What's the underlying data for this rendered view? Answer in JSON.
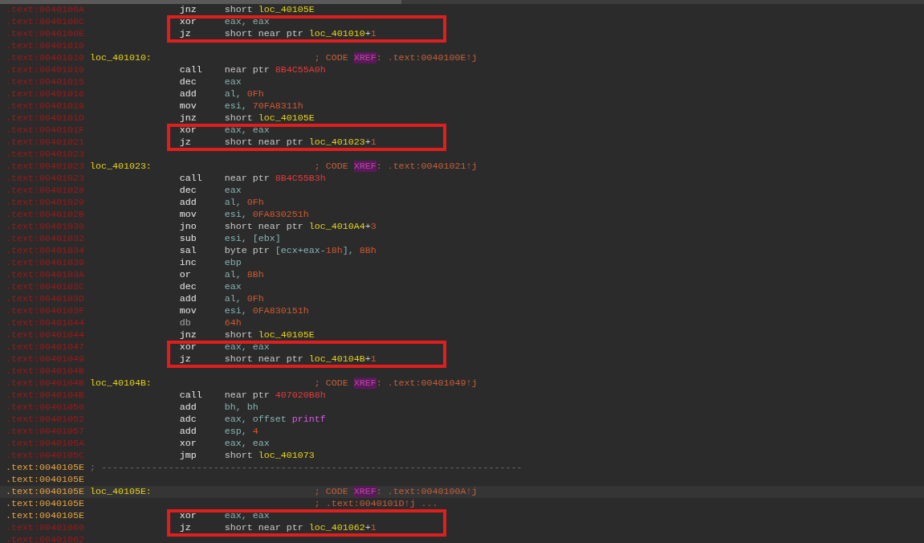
{
  "listing": [
    {
      "addr": ".text:0040100A",
      "flagged": true,
      "mnemonic": "jnz",
      "operands": [
        {
          "text": "short ",
          "kind": "kw"
        },
        {
          "text": "loc_40105E",
          "kind": "loc"
        }
      ]
    },
    {
      "addr": ".text:0040100C",
      "flagged": true,
      "boxed": true,
      "mnemonic": "xor",
      "operands": [
        {
          "text": "eax, eax",
          "kind": "reg"
        }
      ]
    },
    {
      "addr": ".text:0040100E",
      "flagged": true,
      "boxed": true,
      "mnemonic": "jz",
      "operands": [
        {
          "text": "short near ptr ",
          "kind": "kw"
        },
        {
          "text": "loc_401010",
          "kind": "loc"
        },
        {
          "text": "+",
          "kind": "kw"
        },
        {
          "text": "1",
          "kind": "num"
        }
      ]
    },
    {
      "addr": ".text:00401010",
      "flagged": true
    },
    {
      "addr": ".text:00401010",
      "flagged": true,
      "label": "loc_401010:",
      "comment": [
        {
          "text": "; CODE ",
          "kind": "cmt"
        },
        {
          "text": "XREF",
          "kind": "xref"
        },
        {
          "text": ": .text:0040100E↑j",
          "kind": "cmt"
        }
      ]
    },
    {
      "addr": ".text:00401010",
      "flagged": true,
      "mnemonic": "call",
      "operands": [
        {
          "text": "near ptr ",
          "kind": "kw"
        },
        {
          "text": "8B4C55A0h",
          "kind": "target"
        }
      ]
    },
    {
      "addr": ".text:00401015",
      "flagged": true,
      "mnemonic": "dec",
      "operands": [
        {
          "text": "eax",
          "kind": "reg"
        }
      ]
    },
    {
      "addr": ".text:00401016",
      "flagged": true,
      "mnemonic": "add",
      "operands": [
        {
          "text": "al, ",
          "kind": "reg"
        },
        {
          "text": "0Fh",
          "kind": "num"
        }
      ]
    },
    {
      "addr": ".text:00401018",
      "flagged": true,
      "mnemonic": "mov",
      "operands": [
        {
          "text": "esi, ",
          "kind": "reg"
        },
        {
          "text": "70FA8311h",
          "kind": "num"
        }
      ]
    },
    {
      "addr": ".text:0040101D",
      "flagged": true,
      "mnemonic": "jnz",
      "operands": [
        {
          "text": "short ",
          "kind": "kw"
        },
        {
          "text": "loc_40105E",
          "kind": "loc"
        }
      ]
    },
    {
      "addr": ".text:0040101F",
      "flagged": true,
      "boxed": true,
      "mnemonic": "xor",
      "operands": [
        {
          "text": "eax, eax",
          "kind": "reg"
        }
      ]
    },
    {
      "addr": ".text:00401021",
      "flagged": true,
      "boxed": true,
      "mnemonic": "jz",
      "operands": [
        {
          "text": "short near ptr ",
          "kind": "kw"
        },
        {
          "text": "loc_401023",
          "kind": "loc"
        },
        {
          "text": "+",
          "kind": "kw"
        },
        {
          "text": "1",
          "kind": "num"
        }
      ]
    },
    {
      "addr": ".text:00401023",
      "flagged": true
    },
    {
      "addr": ".text:00401023",
      "flagged": true,
      "label": "loc_401023:",
      "comment": [
        {
          "text": "; CODE ",
          "kind": "cmt"
        },
        {
          "text": "XREF",
          "kind": "xref"
        },
        {
          "text": ": .text:00401021↑j",
          "kind": "cmt"
        }
      ]
    },
    {
      "addr": ".text:00401023",
      "flagged": true,
      "mnemonic": "call",
      "operands": [
        {
          "text": "near ptr ",
          "kind": "kw"
        },
        {
          "text": "8B4C55B3h",
          "kind": "target"
        }
      ]
    },
    {
      "addr": ".text:00401028",
      "flagged": true,
      "mnemonic": "dec",
      "operands": [
        {
          "text": "eax",
          "kind": "reg"
        }
      ]
    },
    {
      "addr": ".text:00401029",
      "flagged": true,
      "mnemonic": "add",
      "operands": [
        {
          "text": "al, ",
          "kind": "reg"
        },
        {
          "text": "0Fh",
          "kind": "num"
        }
      ]
    },
    {
      "addr": ".text:0040102B",
      "flagged": true,
      "mnemonic": "mov",
      "operands": [
        {
          "text": "esi, ",
          "kind": "reg"
        },
        {
          "text": "0FA830251h",
          "kind": "num"
        }
      ]
    },
    {
      "addr": ".text:00401030",
      "flagged": true,
      "mnemonic": "jno",
      "operands": [
        {
          "text": "short near ptr ",
          "kind": "kw"
        },
        {
          "text": "loc_4010A4",
          "kind": "loc"
        },
        {
          "text": "+",
          "kind": "kw"
        },
        {
          "text": "3",
          "kind": "num"
        }
      ]
    },
    {
      "addr": ".text:00401032",
      "flagged": true,
      "mnemonic": "sub",
      "operands": [
        {
          "text": "esi, [ebx]",
          "kind": "reg"
        }
      ]
    },
    {
      "addr": ".text:00401034",
      "flagged": true,
      "mnemonic": "sal",
      "operands": [
        {
          "text": "byte ptr ",
          "kind": "kw"
        },
        {
          "text": "[ecx+eax-",
          "kind": "reg"
        },
        {
          "text": "18h",
          "kind": "num"
        },
        {
          "text": "], ",
          "kind": "reg"
        },
        {
          "text": "8Bh",
          "kind": "num"
        }
      ]
    },
    {
      "addr": ".text:00401039",
      "flagged": true,
      "mnemonic": "inc",
      "operands": [
        {
          "text": "ebp",
          "kind": "reg"
        }
      ]
    },
    {
      "addr": ".text:0040103A",
      "flagged": true,
      "mnemonic": "or",
      "operands": [
        {
          "text": "al, ",
          "kind": "reg"
        },
        {
          "text": "8Bh",
          "kind": "num"
        }
      ]
    },
    {
      "addr": ".text:0040103C",
      "flagged": true,
      "mnemonic": "dec",
      "operands": [
        {
          "text": "eax",
          "kind": "reg"
        }
      ]
    },
    {
      "addr": ".text:0040103D",
      "flagged": true,
      "mnemonic": "add",
      "operands": [
        {
          "text": "al, ",
          "kind": "reg"
        },
        {
          "text": "0Fh",
          "kind": "num"
        }
      ]
    },
    {
      "addr": ".text:0040103F",
      "flagged": true,
      "mnemonic": "mov",
      "operands": [
        {
          "text": "esi, ",
          "kind": "reg"
        },
        {
          "text": "0FA830151h",
          "kind": "num"
        }
      ]
    },
    {
      "addr": ".text:00401044",
      "flagged": true,
      "mnemonic": "db",
      "directive": true,
      "operands": [
        {
          "text": "64h",
          "kind": "num"
        }
      ]
    },
    {
      "addr": ".text:00401044",
      "flagged": true,
      "mnemonic": "jnz",
      "operands": [
        {
          "text": "short ",
          "kind": "kw"
        },
        {
          "text": "loc_40105E",
          "kind": "loc"
        }
      ]
    },
    {
      "addr": ".text:00401047",
      "flagged": true,
      "boxed": true,
      "mnemonic": "xor",
      "operands": [
        {
          "text": "eax, eax",
          "kind": "reg"
        }
      ]
    },
    {
      "addr": ".text:00401049",
      "flagged": true,
      "boxed": true,
      "mnemonic": "jz",
      "operands": [
        {
          "text": "short near ptr ",
          "kind": "kw"
        },
        {
          "text": "loc_40104B",
          "kind": "loc"
        },
        {
          "text": "+",
          "kind": "kw"
        },
        {
          "text": "1",
          "kind": "num"
        }
      ]
    },
    {
      "addr": ".text:0040104B",
      "flagged": true
    },
    {
      "addr": ".text:0040104B",
      "flagged": true,
      "label": "loc_40104B:",
      "comment": [
        {
          "text": "; CODE ",
          "kind": "cmt"
        },
        {
          "text": "XREF",
          "kind": "xref"
        },
        {
          "text": ": .text:00401049↑j",
          "kind": "cmt"
        }
      ]
    },
    {
      "addr": ".text:0040104B",
      "flagged": true,
      "mnemonic": "call",
      "operands": [
        {
          "text": "near ptr ",
          "kind": "kw"
        },
        {
          "text": "407020B8h",
          "kind": "target"
        }
      ]
    },
    {
      "addr": ".text:00401050",
      "flagged": true,
      "mnemonic": "add",
      "operands": [
        {
          "text": "bh, bh",
          "kind": "reg"
        }
      ]
    },
    {
      "addr": ".text:00401052",
      "flagged": true,
      "mnemonic": "adc",
      "operands": [
        {
          "text": "eax, offset ",
          "kind": "reg"
        },
        {
          "text": "printf",
          "kind": "func"
        }
      ]
    },
    {
      "addr": ".text:00401057",
      "flagged": true,
      "mnemonic": "add",
      "operands": [
        {
          "text": "esp, ",
          "kind": "reg"
        },
        {
          "text": "4",
          "kind": "num"
        }
      ]
    },
    {
      "addr": ".text:0040105A",
      "flagged": true,
      "mnemonic": "xor",
      "operands": [
        {
          "text": "eax, eax",
          "kind": "reg"
        }
      ]
    },
    {
      "addr": ".text:0040105C",
      "flagged": true,
      "mnemonic": "jmp",
      "operands": [
        {
          "text": "short ",
          "kind": "kw"
        },
        {
          "text": "loc_401073",
          "kind": "loc"
        }
      ]
    },
    {
      "addr": ".text:0040105E",
      "flagged": false,
      "separator": "; ---------------------------------------------------------------------------"
    },
    {
      "addr": ".text:0040105E",
      "flagged": false
    },
    {
      "addr": ".text:0040105E",
      "flagged": false,
      "current": true,
      "label": "loc_40105E:",
      "comment": [
        {
          "text": "; CODE ",
          "kind": "cmt"
        },
        {
          "text": "XREF",
          "kind": "xref"
        },
        {
          "text": ": .text:0040100A↑j",
          "kind": "cmt"
        }
      ]
    },
    {
      "addr": ".text:0040105E",
      "flagged": false,
      "comment": [
        {
          "text": "; .text:0040101D↑j ...",
          "kind": "cmt"
        }
      ]
    },
    {
      "addr": ".text:0040105E",
      "flagged": false,
      "boxed": true,
      "mnemonic": "xor",
      "operands": [
        {
          "text": "eax, eax",
          "kind": "reg"
        }
      ]
    },
    {
      "addr": ".text:00401060",
      "flagged": true,
      "boxed": true,
      "mnemonic": "jz",
      "operands": [
        {
          "text": "short near ptr ",
          "kind": "kw"
        },
        {
          "text": "loc_401062",
          "kind": "loc"
        },
        {
          "text": "+",
          "kind": "kw"
        },
        {
          "text": "1",
          "kind": "num"
        }
      ]
    },
    {
      "addr": ".text:00401062",
      "flagged": true
    }
  ]
}
